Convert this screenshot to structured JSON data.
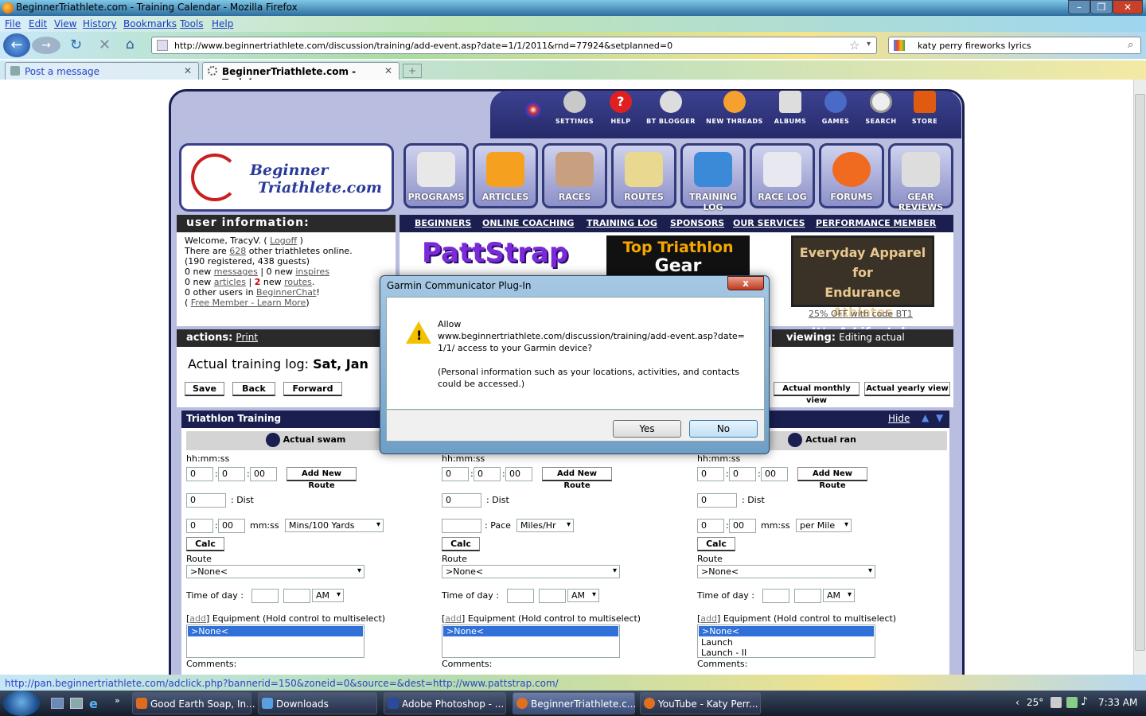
{
  "window": {
    "title": "BeginnerTriathlete.com - Training Calendar - Mozilla Firefox"
  },
  "menu": {
    "items": [
      "File",
      "Edit",
      "View",
      "History",
      "Bookmarks",
      "Tools",
      "Help"
    ]
  },
  "nav": {
    "url": "http://www.beginnertriathlete.com/discussion/training/add-event.asp?date=1/1/2011&rnd=77924&setplanned=0",
    "search": "katy perry fireworks lyrics"
  },
  "tabs": [
    {
      "label": "Post a message"
    },
    {
      "label": "BeginnerTriathlete.com - Trainin..."
    }
  ],
  "site": {
    "logo": [
      "Beginner",
      "Triathlete.com"
    ],
    "tools": [
      "SETTINGS",
      "HELP",
      "BT BLOGGER",
      "NEW THREADS",
      "ALBUMS",
      "GAMES",
      "SEARCH",
      "STORE"
    ],
    "navbuttons": [
      "PROGRAMS",
      "ARTICLES",
      "RACES",
      "ROUTES",
      "TRAINING LOG",
      "RACE LOG",
      "FORUMS",
      "GEAR REVIEWS"
    ],
    "links": [
      "BEGINNERS",
      "ONLINE COACHING",
      "TRAINING LOG",
      "SPONSORS",
      "OUR SERVICES",
      "PERFORMANCE MEMBER"
    ],
    "user_header": "user information:",
    "user": {
      "welcome": "Welcome, TracyV.",
      "logoff": "Logoff",
      "there_are": "There are",
      "online_count": "628",
      "online_rest": "other triathletes online.",
      "registered": "(190 registered, 438 guests)",
      "messages_pre": "0 new",
      "messages": "messages",
      "inspires_pre": "0 new",
      "inspires": "inspires",
      "articles_pre": "0 new",
      "articles": "articles",
      "routes_count": "2",
      "routes_pre": "new",
      "routes": "routes",
      "chat_pre": "0 other users in",
      "chat": "BeginnerChat",
      "free": "Free Member - Learn More"
    },
    "ads": {
      "pattstrap": "PattStrap",
      "top1": "Top Triathlon",
      "top2": "Gear",
      "apparel1": "Everyday Apparel for",
      "apparel2": "Endurance Athletes",
      "apparel3": "It's A Lifestyle Thing",
      "code": "25% OFF with code BT1"
    },
    "actions_label": "actions:",
    "print": "Print",
    "viewing_label": "viewing:",
    "viewing": "Editing actual",
    "log_title": "Actual training log:",
    "log_date": "Sat, Jan",
    "buttons": {
      "save": "Save",
      "back": "Back",
      "forward": "Forward",
      "monthly": "Actual monthly view",
      "yearly": "Actual yearly view"
    },
    "section": "Triathlon Training",
    "hide": "Hide",
    "panels": [
      {
        "head": "Actual swam",
        "time_label": "hh:mm:ss",
        "h": "0",
        "m": "0",
        "s": "00",
        "route_btn": "Add New Route",
        "dist": "0",
        "dist_label": ": Dist",
        "pace_a": "0",
        "pace_b": "00",
        "pace_label": "mm:ss",
        "pace_unit": "Mins/100 Yards",
        "calc": "Calc",
        "route_label": "Route",
        "route": ">None<",
        "tod": "Time of day :",
        "ampm": "AM",
        "equip_add": "add",
        "equip": "Equipment (Hold control to multiselect)",
        "equip_items": [
          ">None<"
        ],
        "comments": "Comments:"
      },
      {
        "head": "",
        "time_label": "hh:mm:ss",
        "h": "0",
        "m": "0",
        "s": "00",
        "route_btn": "Add New Route",
        "dist": "0",
        "dist_label": ": Dist",
        "pace_a": "",
        "pace_b": "",
        "pace_label": ": Pace",
        "pace_unit": "Miles/Hr",
        "calc": "Calc",
        "route_label": "Route",
        "route": ">None<",
        "tod": "Time of day :",
        "ampm": "AM",
        "equip_add": "add",
        "equip": "Equipment (Hold control to multiselect)",
        "equip_items": [
          ">None<"
        ],
        "comments": "Comments:"
      },
      {
        "head": "Actual ran",
        "time_label": "hh:mm:ss",
        "h": "0",
        "m": "0",
        "s": "00",
        "route_btn": "Add New Route",
        "dist": "0",
        "dist_label": ": Dist",
        "pace_a": "0",
        "pace_b": "00",
        "pace_label": "mm:ss",
        "pace_unit": "per Mile",
        "calc": "Calc",
        "route_label": "Route",
        "route": ">None<",
        "tod": "Time of day :",
        "ampm": "AM",
        "equip_add": "add",
        "equip": "Equipment (Hold control to multiselect)",
        "equip_items": [
          ">None<",
          "Launch",
          "Launch - II"
        ],
        "comments": "Comments:"
      }
    ]
  },
  "dialog": {
    "title": "Garmin Communicator Plug-In",
    "close": "x",
    "line1": "Allow",
    "line2": "www.beginnertriathlete.com/discussion/training/add-event.asp?date=",
    "line3": "1/1/ access to your Garmin device?",
    "note1": "(Personal information such as your locations, activities, and contacts",
    "note2": "could be accessed.)",
    "yes": "Yes",
    "no": "No"
  },
  "status": {
    "text": "http://pan.beginnertriathlete.com/adclick.php?bannerid=150&zoneid=0&source=&dest=http://www.pattstrap.com/"
  },
  "taskbar": {
    "items": [
      "Good Earth Soap, In...",
      "Downloads",
      "Adobe Photoshop - ...",
      "BeginnerTriathlete.c...",
      "YouTube - Katy Perr..."
    ],
    "temp": "25°",
    "clock": "7:33 AM"
  },
  "colors": {
    "site_navy": "#1a1f50",
    "link_blue": "#1a3cc0",
    "dialog_no": "#bfe0f6"
  }
}
